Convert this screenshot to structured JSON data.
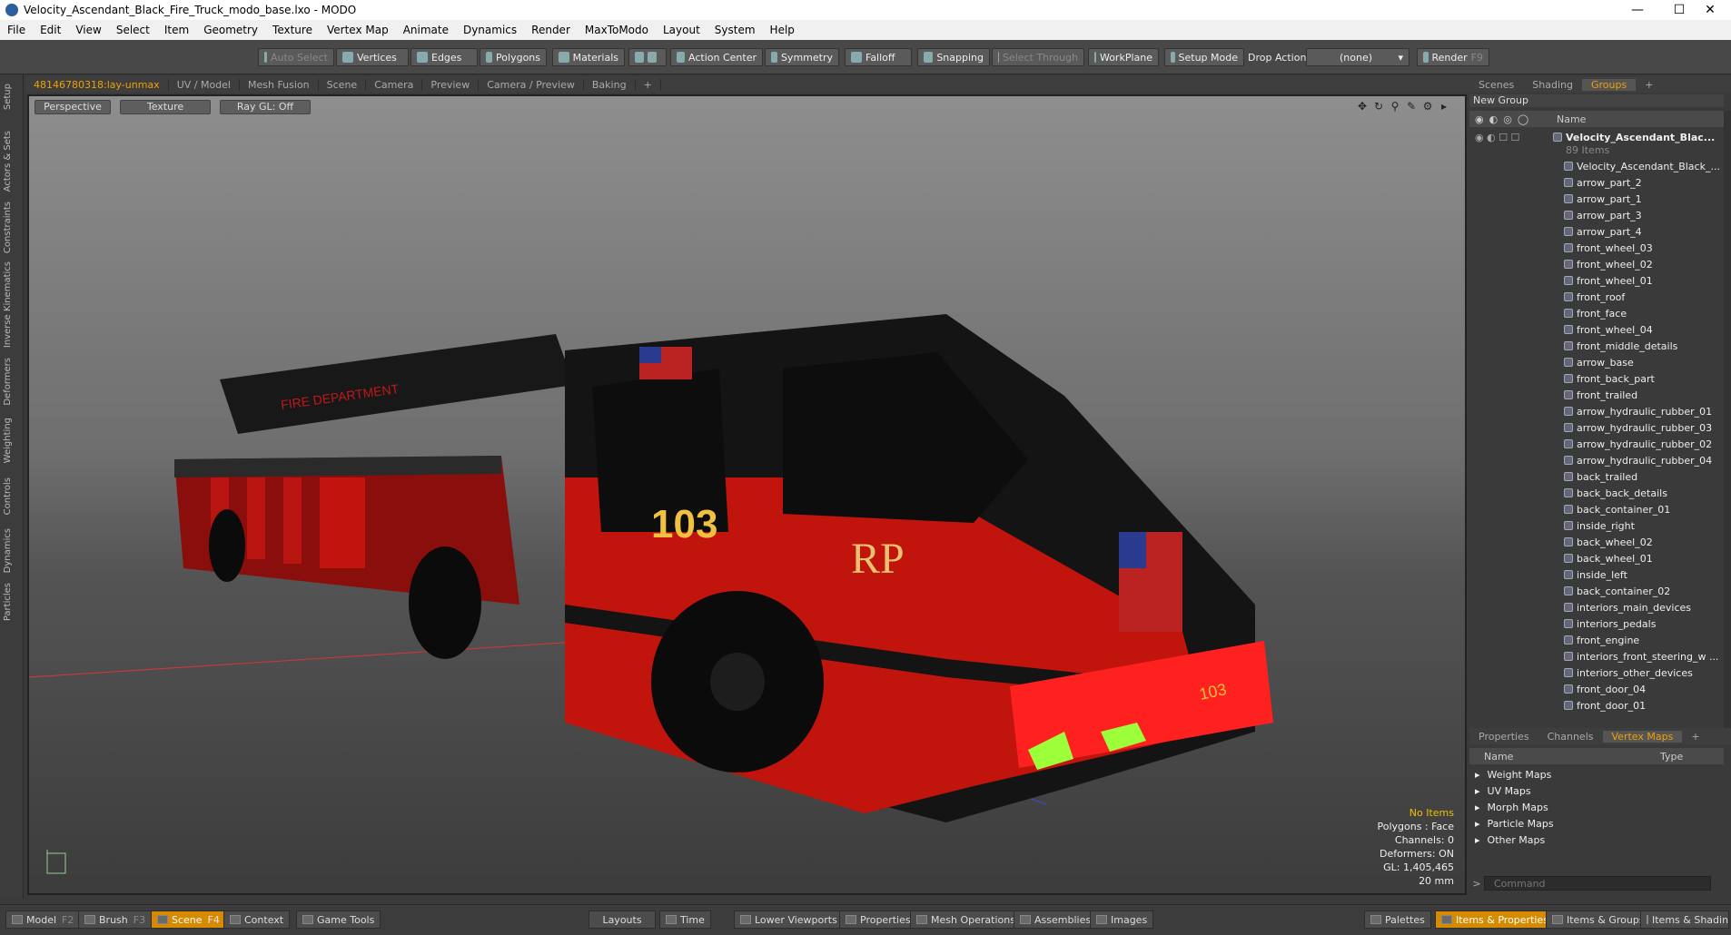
{
  "window": {
    "title": "Velocity_Ascendant_Black_Fire_Truck_modo_base.lxo - MODO"
  },
  "menu": [
    "File",
    "Edit",
    "View",
    "Select",
    "Item",
    "Geometry",
    "Texture",
    "Vertex Map",
    "Animate",
    "Dynamics",
    "Render",
    "MaxToModo",
    "Layout",
    "System",
    "Help"
  ],
  "toolbar": {
    "auto_select": "Auto Select",
    "vertices": "Vertices",
    "edges": "Edges",
    "polygons": "Polygons",
    "materials": "Materials",
    "action_center": "Action Center",
    "symmetry": "Symmetry",
    "falloff": "Falloff",
    "snapping": "Snapping",
    "select_through": "Select Through",
    "workplane": "WorkPlane",
    "setup_mode": "Setup Mode",
    "drop_action": "Drop Action",
    "drop_action_value": "(none)",
    "render": "Render",
    "render_key": "F9"
  },
  "left_tabs": [
    "Setup",
    "Actors & Sets",
    "Constraints",
    "Inverse Kinematics",
    "Deformers",
    "Weighting",
    "Controls",
    "Dynamics",
    "Particles"
  ],
  "viewport_tabs": [
    "48146780318:lay-unmax",
    "UV / Model",
    "Mesh Fusion",
    "Scene",
    "Camera",
    "Preview",
    "Camera / Preview",
    "Baking",
    "+"
  ],
  "viewport": {
    "perspective": "Perspective",
    "texture": "Texture",
    "raygl": "Ray GL: Off",
    "truck_number": "103",
    "bumper_number": "103",
    "ladder_text": "FIRE DEPARTMENT",
    "info": {
      "items": "No Items",
      "polygons": "Polygons : Face",
      "channels": "Channels: 0",
      "deformers": "Deformers: ON",
      "gl": "GL: 1,405,465",
      "scale": "20 mm"
    }
  },
  "right_tabs_top": [
    "Scenes",
    "Shading",
    "Groups",
    "+"
  ],
  "groups": {
    "new_group": "New Group",
    "name_col": "Name",
    "root": "Velocity_Ascendant_Blac...",
    "root_count": "89 Items",
    "items": [
      "Velocity_Ascendant_Black_...",
      "arrow_part_2",
      "arrow_part_1",
      "arrow_part_3",
      "arrow_part_4",
      "front_wheel_03",
      "front_wheel_02",
      "front_wheel_01",
      "front_roof",
      "front_face",
      "front_wheel_04",
      "front_middle_details",
      "arrow_base",
      "front_back_part",
      "front_trailed",
      "arrow_hydraulic_rubber_01",
      "arrow_hydraulic_rubber_03",
      "arrow_hydraulic_rubber_02",
      "arrow_hydraulic_rubber_04",
      "back_trailed",
      "back_back_details",
      "back_container_01",
      "inside_right",
      "back_wheel_02",
      "back_wheel_01",
      "inside_left",
      "back_container_02",
      "interiors_main_devices",
      "interiors_pedals",
      "front_engine",
      "interiors_front_steering_w ...",
      "interiors_other_devices",
      "front_door_04",
      "front_door_01"
    ]
  },
  "right_tabs_bottom": [
    "Properties",
    "Channels",
    "Vertex Maps",
    "+"
  ],
  "vertex_maps": {
    "name_col": "Name",
    "type_col": "Type",
    "items": [
      "Weight Maps",
      "UV Maps",
      "Morph Maps",
      "Particle Maps",
      "Other Maps"
    ]
  },
  "command": {
    "placeholder": "Command"
  },
  "bottombar": {
    "model": "Model",
    "model_key": "F2",
    "brush": "Brush",
    "brush_key": "F3",
    "scene": "Scene",
    "scene_key": "F4",
    "context": "Context",
    "game_tools": "Game Tools",
    "layouts": "Layouts",
    "time": "Time",
    "lower_viewports": "Lower Viewports",
    "properties": "Properties",
    "mesh_operations": "Mesh Operations",
    "assemblies": "Assemblies",
    "images": "Images",
    "palettes": "Palettes",
    "items_properties": "Items & Properties",
    "items_groups": "Items & Groups",
    "items_shading": "Items & Shading"
  },
  "colors": {
    "accent": "#f0a000",
    "truck_red": "#c0140c",
    "truck_black": "#141414"
  }
}
